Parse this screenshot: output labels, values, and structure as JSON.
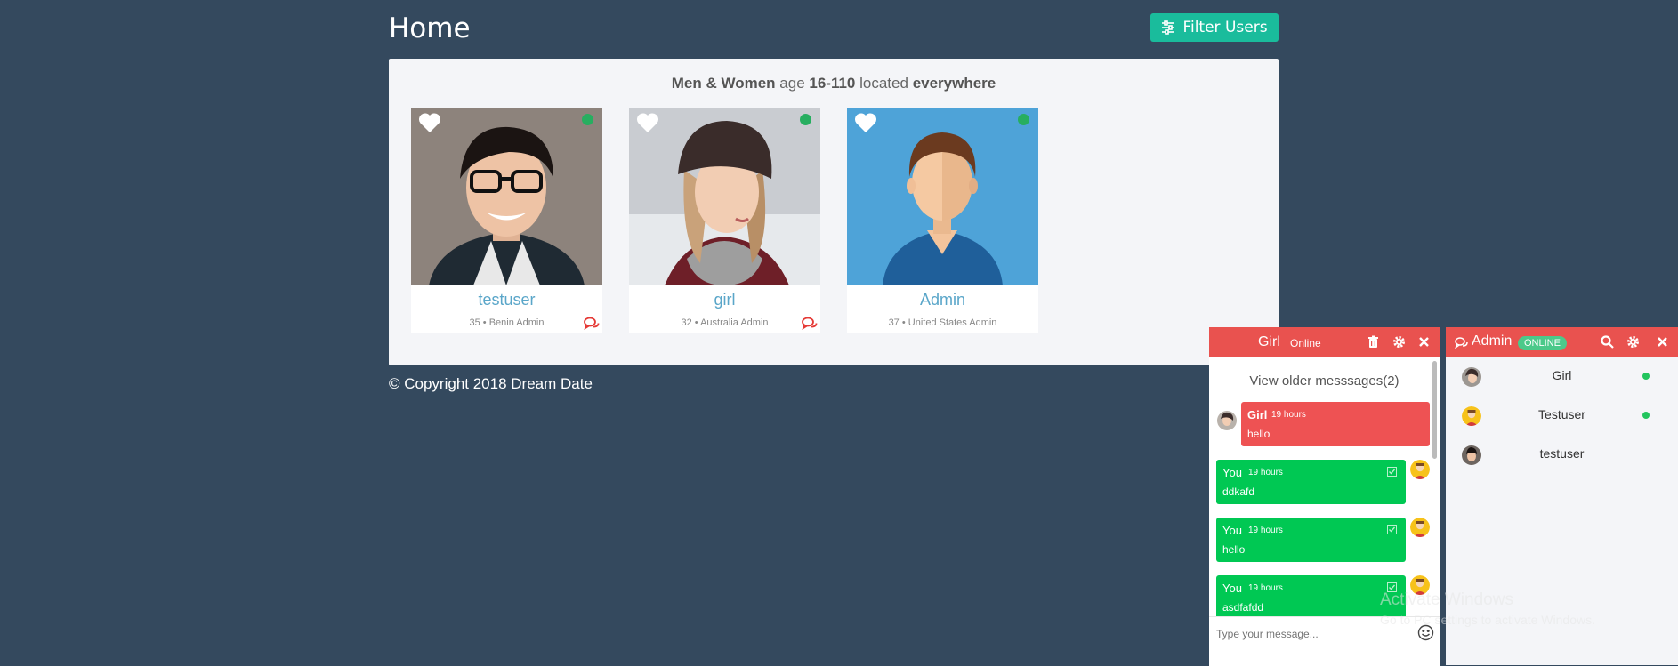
{
  "page": {
    "title": "Home"
  },
  "header": {
    "filter_button": "Filter Users"
  },
  "filter": {
    "gender": "Men & Women",
    "age_label": "age",
    "age_range": "16-110",
    "located_label": "located",
    "location": "everywhere"
  },
  "users": [
    {
      "name": "testuser",
      "meta": "35 • Benin Admin",
      "online": true,
      "show_chat": true
    },
    {
      "name": "girl",
      "meta": "32 • Australia Admin",
      "online": true,
      "show_chat": true
    },
    {
      "name": "Admin",
      "meta": "37 • United States Admin",
      "online": true,
      "show_chat": false
    }
  ],
  "footer": {
    "copyright": "© Copyright 2018 Dream Date"
  },
  "chat": {
    "name": "Girl",
    "status": "Online",
    "older": "View older messsages(2)",
    "messages": [
      {
        "from": "Girl",
        "time": "19 hours",
        "text": "hello"
      },
      {
        "from": "You",
        "time": "19 hours",
        "text": "ddkafd"
      },
      {
        "from": "You",
        "time": "19 hours",
        "text": "hello"
      },
      {
        "from": "You",
        "time": "19 hours",
        "text": "asdfafdd"
      }
    ],
    "input_placeholder": "Type your message..."
  },
  "user_list": {
    "title": "Admin",
    "status_badge": "ONLINE",
    "items": [
      {
        "name": "Girl",
        "online": true
      },
      {
        "name": "Testuser",
        "online": true
      },
      {
        "name": "testuser",
        "online": false
      }
    ]
  },
  "watermark": {
    "line1": "Activate Windows",
    "line2": "Go to PC settings to activate Windows."
  },
  "colors": {
    "background": "#34495e",
    "accent": "#1abc9c",
    "chat_header": "#e9524f",
    "incoming_bubble": "#ee5253",
    "outgoing_bubble": "#00c853",
    "username": "#5aa6c9",
    "online": "#27ae60"
  }
}
